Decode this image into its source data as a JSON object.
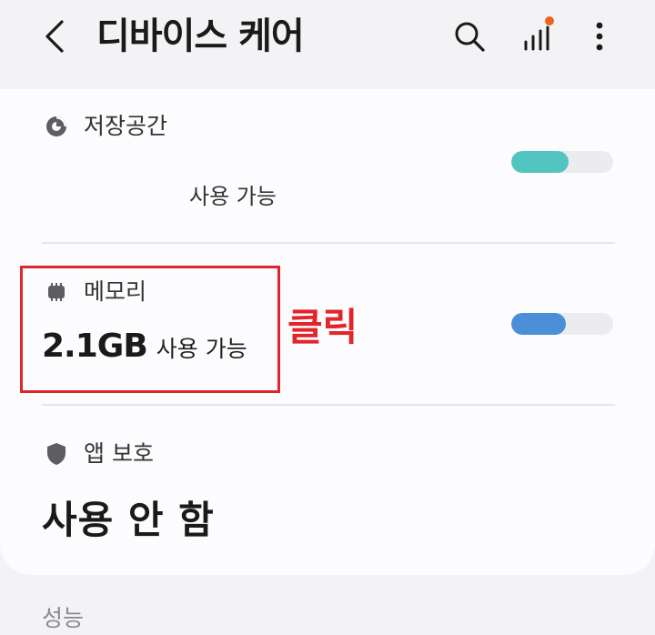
{
  "header": {
    "title": "디바이스 케어",
    "icons": {
      "back": "chevron-left-icon",
      "search": "search-icon",
      "signal": "signal-bars-icon",
      "more": "more-vertical-icon"
    },
    "notification_dot_color": "#e8651f"
  },
  "storage": {
    "label": "저장공간",
    "subtext": "사용 가능",
    "bar_fill_fraction": 0.56,
    "bar_color": "#52c5c0",
    "icon": "pie-chart-icon"
  },
  "memory": {
    "label": "메모리",
    "value": "2.1GB",
    "subtext": "사용 가능",
    "bar_fill_fraction": 0.54,
    "bar_color": "#4b8fd8",
    "icon": "memory-chip-icon"
  },
  "annotation": {
    "text": "클릭",
    "color": "#e0262c"
  },
  "app_protection": {
    "label": "앱 보호",
    "value": "사용 안 함",
    "icon": "shield-icon"
  },
  "performance": {
    "label": "성능"
  }
}
